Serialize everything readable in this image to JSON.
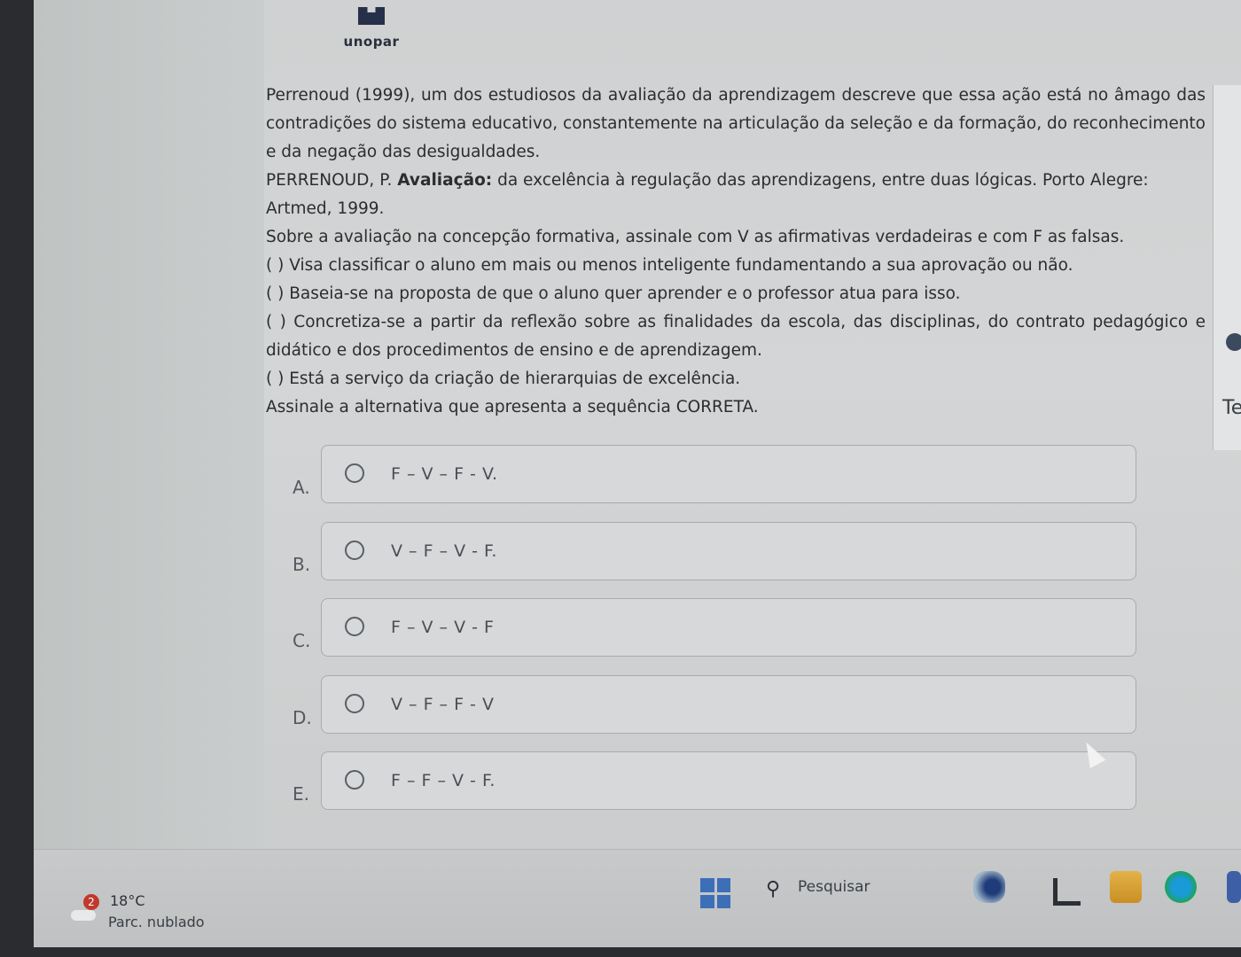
{
  "header": {
    "logo_text": "unopar"
  },
  "question": {
    "paragraph": "Perrenoud (1999), um dos estudiosos da avaliação da aprendizagem descreve que essa ação está no âmago das contradições do sistema educativo, constantemente na articulação da seleção e da formação, do reconhecimento e da negação das desigualdades.",
    "reference_author": "PERRENOUD, P.",
    "reference_title": "Avaliação:",
    "reference_rest": "da excelência à regulação das aprendizagens, entre duas lógicas. Porto Alegre: Artmed, 1999.",
    "instruction": "Sobre a avaliação na concepção formativa, assinale com V as afirmativas verdadeiras e com F as falsas.",
    "statements": [
      "( ) Visa classificar o aluno em mais ou menos inteligente fundamentando a sua aprovação ou não.",
      "( ) Baseia-se na proposta de que o aluno quer aprender e o professor atua para isso.",
      "( ) Concretiza-se a partir da reflexão sobre as finalidades da escola, das disciplinas, do contrato pedagógico e didático e dos procedimentos de ensino e de aprendizagem.",
      "( ) Está a serviço da criação de hierarquias de excelência."
    ],
    "prompt": "Assinale a alternativa que apresenta a sequência CORRETA."
  },
  "options": [
    {
      "letter": "A.",
      "text": "F – V – F - V."
    },
    {
      "letter": "B.",
      "text": "V – F – V - F."
    },
    {
      "letter": "C.",
      "text": "F – V – V - F"
    },
    {
      "letter": "D.",
      "text": "V – F – F - V"
    },
    {
      "letter": "E.",
      "text": "F – F – V - F."
    }
  ],
  "side_panel": {
    "partial_text": "Te"
  },
  "taskbar": {
    "weather_badge": "2",
    "temperature": "18°C",
    "condition": "Parc. nublado",
    "search_label": "Pesquisar"
  }
}
